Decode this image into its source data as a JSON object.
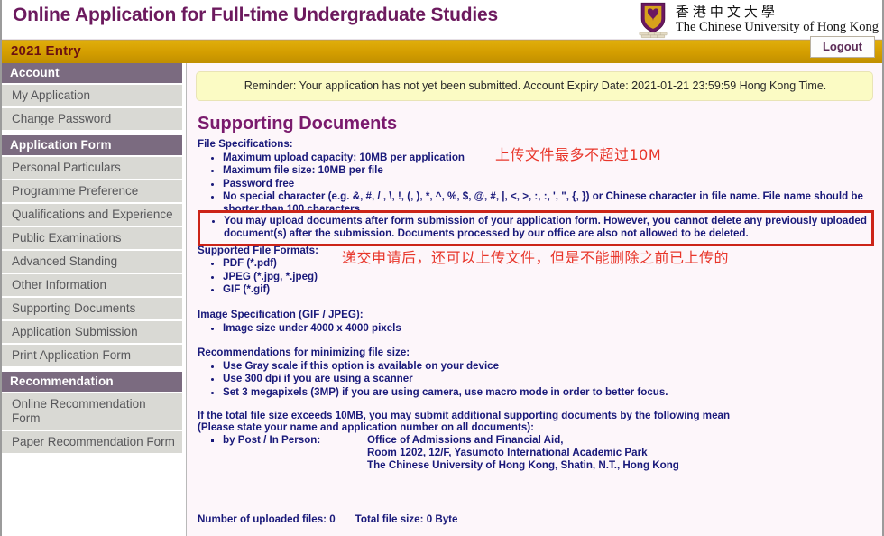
{
  "header": {
    "title": "Online Application for Full-time Undergraduate Studies",
    "logo_cn": "香港中文大學",
    "logo_en": "The Chinese University of Hong Kong"
  },
  "goldbar": {
    "entry_label": "2021 Entry",
    "logout_label": "Logout"
  },
  "sidebar": {
    "sections": [
      {
        "header": "Account",
        "items": [
          "My Application",
          "Change Password"
        ]
      },
      {
        "header": "Application Form",
        "items": [
          "Personal Particulars",
          "Programme Preference",
          "Qualifications and Experience",
          "Public Examinations",
          "Advanced Standing",
          "Other Information",
          "Supporting Documents",
          "Application Submission",
          "Print Application Form"
        ]
      },
      {
        "header": "Recommendation",
        "items": [
          "Online Recommendation Form",
          "Paper Recommendation Form"
        ]
      }
    ]
  },
  "content": {
    "reminder": "Reminder: Your application has not yet been submitted. Account Expiry Date: 2021-01-21 23:59:59 Hong Kong Time.",
    "page_title": "Supporting Documents",
    "file_spec_heading": "File Specifications:",
    "file_spec_items": [
      "Maximum upload capacity: 10MB per application",
      "Maximum file size: 10MB per file",
      "Password free",
      "No special character (e.g. &, #, / , \\, !, (, ), *, ^, %, $, @, #, |, <, >, :, :, ', \", {, }) or Chinese character in file name. File name should be shorter than 100 characters"
    ],
    "highlighted_item": "You may upload documents after form submission of your application form. However, you cannot delete any previously uploaded document(s) after the submission. Documents processed by our office are also not allowed to be deleted.",
    "formats_heading": "Supported File Formats:",
    "formats_items": [
      "PDF (*.pdf)",
      "JPEG (*.jpg, *.jpeg)",
      "GIF (*.gif)"
    ],
    "image_spec_heading": "Image Specification (GIF / JPEG):",
    "image_spec_items": [
      "Image size under 4000 x 4000 pixels"
    ],
    "recommend_heading": "Recommendations for minimizing file size:",
    "recommend_items": [
      "Use Gray scale if this option is available on your device",
      "Use 300 dpi if you are using a scanner",
      "Set 3 megapixels (3MP) if you are using camera, use macro mode in order to better focus."
    ],
    "exceed_line_1": "If the total file size exceeds 10MB, you may submit additional supporting documents by the following mean",
    "exceed_line_2": "(Please state your name and application number on all documents):",
    "post_label": "by Post / In Person:",
    "post_address": [
      "Office of Admissions and Financial Aid,",
      "Room 1202, 12/F, Yasumoto International Academic Park",
      "The Chinese University of Hong Kong, Shatin, N.T., Hong Kong"
    ],
    "uploaded_count_label": "Number of uploaded files: 0",
    "total_size_label": "Total file size: 0 Byte",
    "annotation_1": "上传文件最多不超过10M",
    "annotation_2": "递交申请后，还可以上传文件，但是不能删除之前已上传的"
  },
  "colors": {
    "brand_purple": "#6c1a5e",
    "gold_bar": "#d39d00",
    "nav_header": "#7b6b80",
    "nav_item": "#d9d9d4",
    "body_text": "#19197a",
    "annotation_red": "#e8352a",
    "highlight_box": "#cc2418",
    "reminder_bg": "#fbfbc4"
  }
}
